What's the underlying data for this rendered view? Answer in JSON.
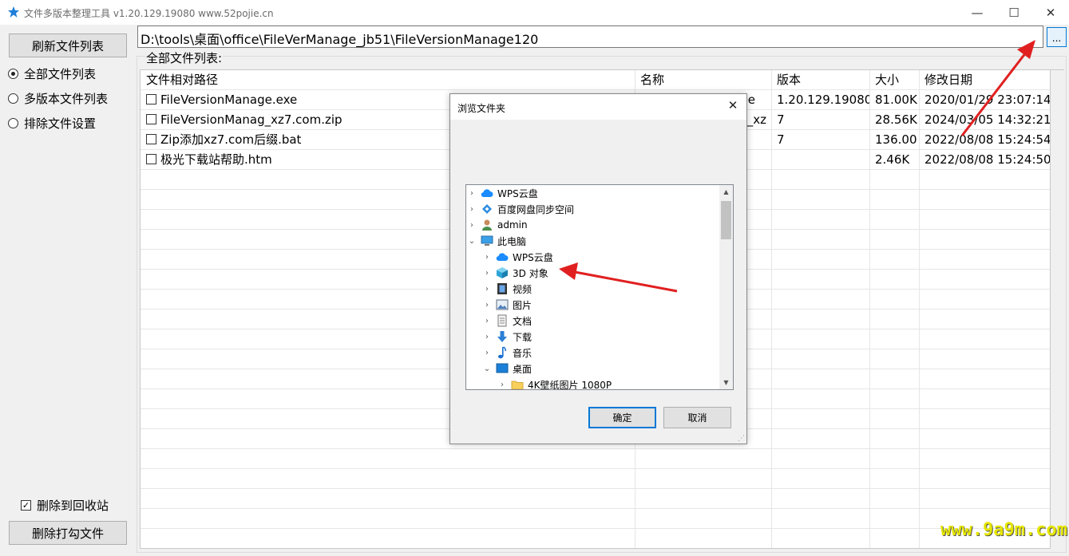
{
  "window": {
    "title": "文件多版本整理工具 v1.20.129.19080 www.52pojie.cn",
    "minimize_glyph": "—",
    "maximize_glyph": "☐",
    "close_glyph": "✕"
  },
  "sidebar": {
    "refresh_label": "刷新文件列表",
    "radios": [
      {
        "label": "全部文件列表",
        "selected": true
      },
      {
        "label": "多版本文件列表",
        "selected": false
      },
      {
        "label": "排除文件设置",
        "selected": false
      }
    ],
    "recycle_label": "删除到回收站",
    "recycle_checked": true,
    "recycle_mark": "✓",
    "delete_label": "删除打勾文件"
  },
  "path": {
    "value": "D:\\tools\\桌面\\office\\FileVerManage_jb51\\FileVersionManage120",
    "browse_label": "..."
  },
  "group": {
    "label": "全部文件列表:"
  },
  "table": {
    "columns": [
      "文件相对路径",
      "名称",
      "版本",
      "大小",
      "修改日期"
    ],
    "rows": [
      {
        "path": "FileVersionManage.exe",
        "name": "e",
        "version": "1.20.129.19080",
        "size": "81.00K",
        "date": "2020/01/29 23:07:14"
      },
      {
        "path": "FileVersionManag_xz7.com.zip",
        "name": "_xz",
        "version": "7",
        "size": "28.56K",
        "date": "2024/03/05 14:32:21"
      },
      {
        "path": "Zip添加xz7.com后缀.bat",
        "name": "",
        "version": "7",
        "size": "136.00",
        "date": "2022/08/08 15:24:54"
      },
      {
        "path": "极光下载站帮助.htm",
        "name": "",
        "version": "",
        "size": "2.46K",
        "date": "2022/08/08 15:24:50"
      }
    ]
  },
  "dialog": {
    "title": "浏览文件夹",
    "close_glyph": "✕",
    "tree": [
      {
        "label": "WPS云盘",
        "level": 0,
        "chevron": "›",
        "icon": "cloud-icon"
      },
      {
        "label": "百度网盘同步空间",
        "level": 0,
        "chevron": "›",
        "icon": "baidu-sync-icon"
      },
      {
        "label": "admin",
        "level": 0,
        "chevron": "›",
        "icon": "user-icon"
      },
      {
        "label": "此电脑",
        "level": 0,
        "chevron": "⌄",
        "icon": "computer-icon"
      },
      {
        "label": "WPS云盘",
        "level": 1,
        "chevron": "›",
        "icon": "cloud-icon"
      },
      {
        "label": "3D 对象",
        "level": 1,
        "chevron": "›",
        "icon": "3d-objects-icon"
      },
      {
        "label": "视频",
        "level": 1,
        "chevron": "›",
        "icon": "video-icon"
      },
      {
        "label": "图片",
        "level": 1,
        "chevron": "›",
        "icon": "pictures-icon"
      },
      {
        "label": "文档",
        "level": 1,
        "chevron": "›",
        "icon": "documents-icon"
      },
      {
        "label": "下载",
        "level": 1,
        "chevron": "›",
        "icon": "download-icon"
      },
      {
        "label": "音乐",
        "level": 1,
        "chevron": "›",
        "icon": "music-icon"
      },
      {
        "label": "桌面",
        "level": 1,
        "chevron": "⌄",
        "icon": "desktop-icon"
      },
      {
        "label": "4K壁纸图片 1080P",
        "level": 2,
        "chevron": "›",
        "icon": "folder-icon"
      }
    ],
    "ok_label": "确定",
    "cancel_label": "取消"
  },
  "watermark": "www.9a9m.com",
  "colors": {
    "accent": "#0078d7",
    "arrow": "#e02020",
    "watermark": "#e6e600"
  }
}
